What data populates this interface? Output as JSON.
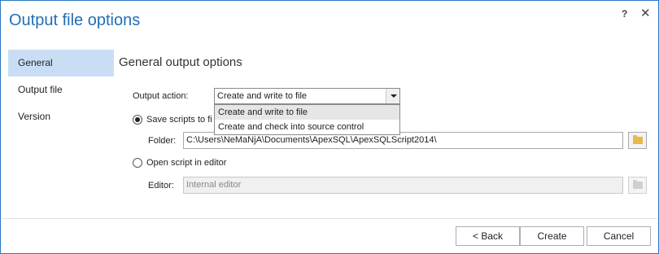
{
  "dialog": {
    "title": "Output file options",
    "help_label": "?",
    "close_label": "✕"
  },
  "sidebar": {
    "items": [
      {
        "label": "General",
        "active": true
      },
      {
        "label": "Output file",
        "active": false
      },
      {
        "label": "Version",
        "active": false
      }
    ]
  },
  "section": {
    "title": "General output options"
  },
  "output_action": {
    "label": "Output action:",
    "value": "Create and write to file",
    "options": [
      "Create and write to file",
      "Create and check into source control"
    ]
  },
  "save_scripts": {
    "label": "Save scripts to fi",
    "checked": true
  },
  "folder": {
    "label": "Folder:",
    "value": "C:\\Users\\NeMaNjA\\Documents\\ApexSQL\\ApexSQLScript2014\\"
  },
  "open_script": {
    "label": "Open script in editor",
    "checked": false
  },
  "editor": {
    "label": "Editor:",
    "placeholder": "Internal editor"
  },
  "icons": {
    "folder_browse": "folder-icon"
  },
  "colors": {
    "title": "#1f6fb5",
    "border": "#2b78c4",
    "sidebar_active": "#c9def5"
  },
  "footer": {
    "back_label": "< Back",
    "create_label": "Create",
    "cancel_label": "Cancel"
  }
}
